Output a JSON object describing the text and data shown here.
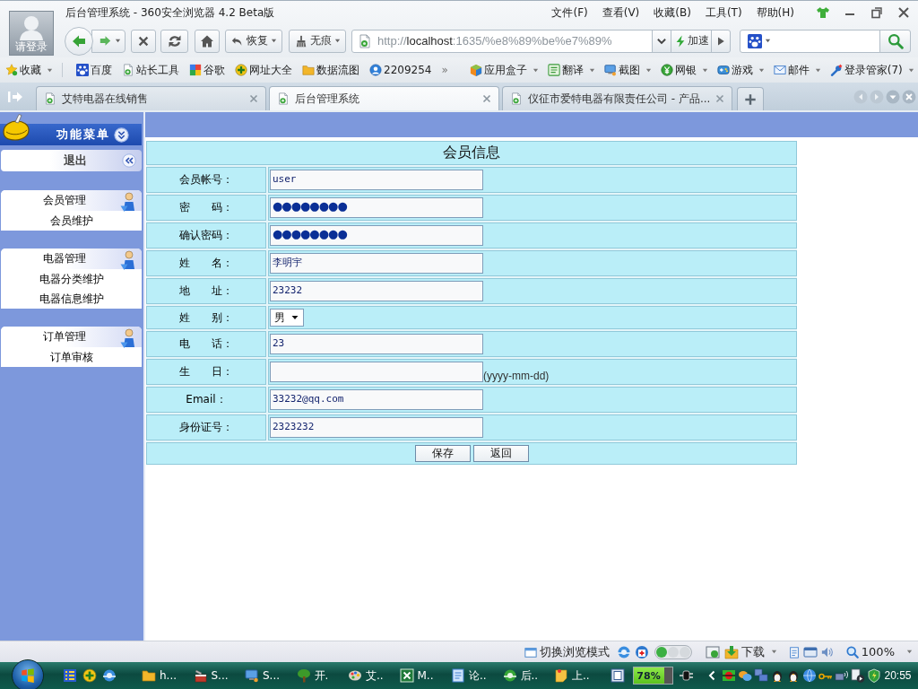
{
  "window": {
    "title": "后台管理系统 - 360安全浏览器 4.2 Beta版",
    "login": "请登录"
  },
  "menu": [
    "文件(F)",
    "查看(V)",
    "收藏(B)",
    "工具(T)",
    "帮助(H)"
  ],
  "toolbar": {
    "restore": "恢复",
    "incognito": "无痕",
    "address": {
      "scheme": "http://",
      "host": "localhost",
      "rest": ":1635/%e8%89%be%e7%89%"
    },
    "accelerate": "加速"
  },
  "favorites": "收藏",
  "bookmarks": [
    "百度",
    "站长工具",
    "谷歌",
    "网址大全",
    "数据流图",
    "2209254"
  ],
  "bookmarks_more": "»",
  "tools": [
    "应用盒子",
    "翻译",
    "截图",
    "网银",
    "游戏",
    "邮件",
    "登录管家(7)"
  ],
  "tabs": [
    {
      "label": "艾特电器在线销售",
      "selected": false
    },
    {
      "label": "后台管理系统",
      "selected": true
    },
    {
      "label": "仪征市爱特电器有限责任公司 - 产品...",
      "selected": false
    }
  ],
  "sidebar": {
    "title": "功能菜单",
    "logout": "退出",
    "groups": [
      {
        "title": "会员管理",
        "items": [
          "会员维护"
        ]
      },
      {
        "title": "电器管理",
        "items": [
          "电器分类维护",
          "电器信息维护"
        ]
      },
      {
        "title": "订单管理",
        "items": [
          "订单审核"
        ]
      }
    ]
  },
  "form": {
    "title": "会员信息",
    "fields": [
      {
        "label": "会员帐号：",
        "kind": "text",
        "value": "user"
      },
      {
        "label": "密　　码：",
        "kind": "password",
        "value": "●●●●●●●●"
      },
      {
        "label": "确认密码：",
        "kind": "password",
        "value": "●●●●●●●●"
      },
      {
        "label": "姓　　名：",
        "kind": "text",
        "value": "李明宇"
      },
      {
        "label": "地　　址：",
        "kind": "text",
        "value": "23232"
      },
      {
        "label": "姓　　别：",
        "kind": "select",
        "value": "男"
      },
      {
        "label": "电　　话：",
        "kind": "text",
        "value": "23"
      },
      {
        "label": "生　　日：",
        "kind": "text",
        "hint": "(yyyy-mm-dd)"
      },
      {
        "label": "Email：",
        "kind": "text",
        "value": "33232@qq.com"
      },
      {
        "label": "身份证号：",
        "kind": "text",
        "value": "2323232"
      }
    ],
    "buttons": [
      "保存",
      "返回"
    ]
  },
  "status_bar": {
    "mode_switch": "切换浏览模式",
    "downloads": "下载",
    "zoom": "100%"
  },
  "taskbar": {
    "tasks": [
      "h...",
      "S...",
      "S...",
      "开.",
      "艾..",
      "M..",
      "论..",
      "后..",
      "上.."
    ],
    "battery": "78%",
    "clock": "20:55"
  }
}
